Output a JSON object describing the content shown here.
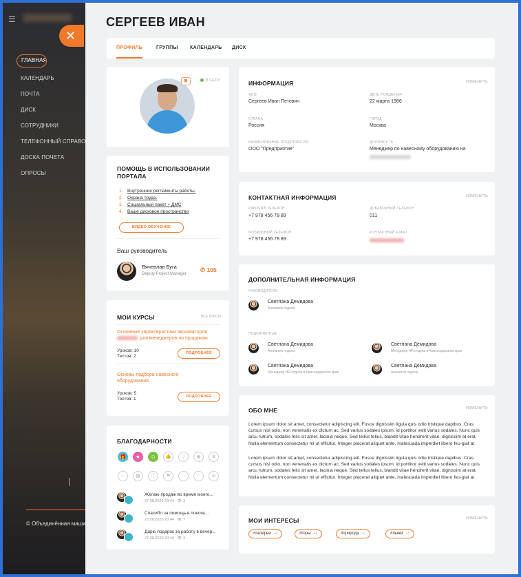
{
  "sidebar": {
    "items": [
      {
        "label": "ГЛАВНАЯ"
      },
      {
        "label": "КАЛЕНДАРЬ"
      },
      {
        "label": "ПОЧТА"
      },
      {
        "label": "ДИСК"
      },
      {
        "label": "СОТРУДНИКИ"
      },
      {
        "label": "ТЕЛЕФОННЫЙ СПРАВОЧНИК"
      },
      {
        "label": "ДОСКА ПОЧЕТА"
      },
      {
        "label": "ОПРОСЫ"
      }
    ],
    "copyright": "© Объединённая маши",
    "close_glyph": "✕",
    "menu_glyph": "☰"
  },
  "header": {
    "title": "СЕРГЕЕВ ИВАН"
  },
  "tabs": [
    {
      "label": "ПРОФИЛЬ"
    },
    {
      "label": "ГРУППЫ"
    },
    {
      "label": "КАЛЕНДАРЬ"
    },
    {
      "label": "ДИСК"
    }
  ],
  "profile": {
    "status": "В СЕТИ"
  },
  "help": {
    "title": "ПОМОЩЬ В ИСПОЛЬЗОВАНИИ ПОРТАЛА",
    "links": [
      {
        "n": "1.",
        "text": "Внутренние регламенты работы."
      },
      {
        "n": "2.",
        "text": "Охрана труда."
      },
      {
        "n": "3.",
        "text": "Социальный пакет + ДМС"
      },
      {
        "n": "4.",
        "text": "Ваше дисковое пространство"
      }
    ],
    "video_button": "ВИДЕО ОБУЧЕНИЕ",
    "manager_title": "Ваш руководитель",
    "manager_name": "Вячевлав Буга",
    "manager_role": "Deputy Project Manager",
    "manager_ext": "105"
  },
  "courses": {
    "title": "МОИ КУРСЫ",
    "all_link": "ВСЕ КУРСЫ",
    "items": [
      {
        "title_line1": "Основные характеристики экскаваторов",
        "title_line2": "для менеджеров по продажам",
        "lessons": "Уроков: 10",
        "tests": "Тестов: 2",
        "button": "ПОДРОБНЕЕ"
      },
      {
        "title_line1": "Основы подбора навесного",
        "title_line2": "оборудования",
        "lessons": "Уроков: 5",
        "tests": "Тестов: 1",
        "button": "ПОДРОБНЕЕ"
      }
    ]
  },
  "thanks": {
    "title": "БЛАГОДАРНОСТИ",
    "badges_active": [
      {
        "icon": "gift-icon",
        "glyph": "🎁",
        "color": "#3fc0d8",
        "count": "1"
      },
      {
        "icon": "medal-icon",
        "glyph": "★",
        "color": "#e45fa8",
        "count": "1"
      },
      {
        "icon": "smile-icon",
        "glyph": "☺",
        "color": "#7cc243",
        "count": "1"
      }
    ],
    "badges_inactive": [
      "👍",
      "▽",
      "◉",
      "♛",
      "☆",
      "▦",
      "ⓘ",
      "⚑",
      "☆",
      "♡",
      "⊜"
    ],
    "items": [
      {
        "text": "Желаю продаж во время моего...",
        "date": "27.08.2020 20:44",
        "views": "3"
      },
      {
        "text": "Спасибо за помощь в поеске...",
        "date": "27.08.2020 20:44",
        "views": "7"
      },
      {
        "text": "Дарю подарок за работу в вечер...",
        "date": "27.08.2020 20:44",
        "views": "3"
      }
    ]
  },
  "info": {
    "title": "ИНФОРМАЦИЯ",
    "edit": "ИЗМЕНИТЬ",
    "fio_label": "ФИО",
    "fio": "Сергеев Иван Петович",
    "birthday_label": "ДЕНЬ РОЖДЕНИЯ",
    "birthday": "22 марта 1986",
    "country_label": "СТРАНА",
    "country": "Россия",
    "city_label": "ГОРОД",
    "city": "Москва",
    "company_label": "НАИМЕНОВАНИЕ ПРЕДПРИЯТИЯ",
    "company": "ООО \"Предприятие\"",
    "position_label": "ДОЛЖНОСТЬ",
    "position": "Менеджер по навесному оборудованию на"
  },
  "contacts": {
    "title": "КОНТАКТНАЯ ИНФОРМАЦИЯ",
    "edit": "ИЗМЕНИТЬ",
    "work_phone_label": "РАБОЧИЙ ТЕЛЕФОН",
    "work_phone": "+7 978 456 78 89",
    "ext_label": "ДОБАВОЧНЫЙ ТЕЛЕФОН",
    "ext": "011",
    "mobile_label": "МОБИЛЬНЫЙ ТЕЛЕФОН",
    "mobile": "+7 978 456 78 89",
    "email_label": "КОНТАКТНЫЙ E-MAIL"
  },
  "extra": {
    "title": "ДОПОЛНИТЕЛЬНАЯ ИНФОРМАЦИЯ",
    "manager_label": "РУКОВОДИТЕЛЬ",
    "manager": {
      "name": "Светлана Демидова",
      "role": "Аналитик отдела"
    },
    "subs_label": "ПОДЧИНЕННЫЕ",
    "subs": [
      {
        "name": "Светлана Демидова",
        "role": "Аналитик отдела"
      },
      {
        "name": "Светлана Демидова",
        "role": "Менеджер HR отдела в Краснодарском крае"
      },
      {
        "name": "Светлана Демидова",
        "role": "Менеджер HR отдела в Краснодарском крае"
      },
      {
        "name": "Светлана Демидова",
        "role": "Аналитик отдела"
      }
    ]
  },
  "about": {
    "title": "ОБО МНЕ",
    "edit": "ИЗМЕНИТЬ",
    "p1": "Lorem ipsum dolor sit amet, consectetur adipiscing elit. Fusce dignissim  ligula quis odio tristique dapibus. Cras cursus nisl odio, non  venenatis ex dictum ac. Sed varius sodales ipsum, id porttitor velit  varius sodales. Nunc quis arcu rutrum, sodales felis sit amet, lacinia  neque. Sed tellus tellus, blandit vitae hendrerit vitae, dignissim at erat. Nulla elementum consectetur mi ut efficitur. Integer placerat  aliquet ante, malesuada imperdiet libero feu-giat at.",
    "p2": "Lorem ipsum dolor sit amet, consectetur adipiscing elit. Fusce dignissim  ligula quis odio tristique dapibus. Cras cursus nisl odio, non  venenatis ex dictum ac. Sed varius sodales ipsum, id porttitor velit  varius sodales. Nunc quis arcu rutrum, sodales felis sit amet, lacinia  neque. Sed tellus tellus, blandit vitae hendrerit vitae, dignissim at erat. Nulla elementum consectetur mi ut efficitur. Integer placerat  aliquet ante, malesuada imperdiet libero feu-giat at."
  },
  "interests": {
    "title": "МОИ ИНТЕРЕСЫ",
    "edit": "ИЗМЕНИТЬ",
    "tags": [
      {
        "label": "#галереи",
        "count": "+3"
      },
      {
        "label": "#горы",
        "count": "+1"
      },
      {
        "label": "#природа",
        "count": "+1"
      },
      {
        "label": "#лыжи",
        "count": "+1"
      }
    ]
  },
  "colors": {
    "accent": "#f07a2a",
    "frame": "#2f6fd6",
    "online": "#5fc04a"
  }
}
